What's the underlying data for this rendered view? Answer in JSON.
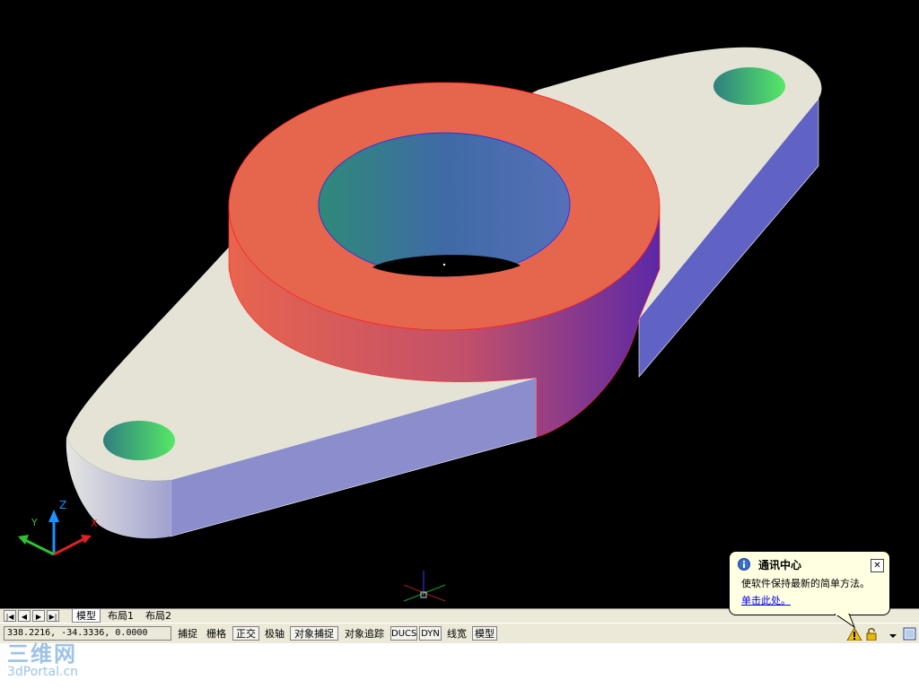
{
  "viewport": {
    "background": "#000000",
    "axis_labels": {
      "z": "Z",
      "y": "Y",
      "x": "X"
    }
  },
  "tabs": {
    "nav": [
      "|◀",
      "◀",
      "▶",
      "▶|"
    ],
    "items": [
      {
        "label": "模型",
        "active": true
      },
      {
        "label": "布局1",
        "active": false
      },
      {
        "label": "布局2",
        "active": false
      }
    ]
  },
  "status": {
    "coords": "338.2216, -34.3336, 0.0000",
    "toggles": [
      {
        "label": "捕捉",
        "on": false
      },
      {
        "label": "栅格",
        "on": false
      },
      {
        "label": "正交",
        "on": true
      },
      {
        "label": "极轴",
        "on": false
      },
      {
        "label": "对象捕捉",
        "on": true
      },
      {
        "label": "对象追踪",
        "on": false
      },
      {
        "label": "DUCS",
        "on": true
      },
      {
        "label": "DYN",
        "on": true
      },
      {
        "label": "线宽",
        "on": false
      },
      {
        "label": "模型",
        "on": true
      }
    ]
  },
  "balloon": {
    "title": "通讯中心",
    "message": "使软件保持最新的简单方法。",
    "link": "单击此处。",
    "close": "✕"
  },
  "watermark": {
    "big": "三维网",
    "small": "3dPortal.cn"
  },
  "colors": {
    "plate_top": "#e4e3d6",
    "plate_side": "#8a8ccc",
    "plate_side_dark": "#5f60c2",
    "boss_top": "#e8654c",
    "boss_side_left": "#e06450",
    "boss_side_right": "#6a2a9a",
    "hole_green": "#4be05a",
    "hole_teal": "#2e8a7a",
    "bore_blue": "#3f6db0"
  }
}
